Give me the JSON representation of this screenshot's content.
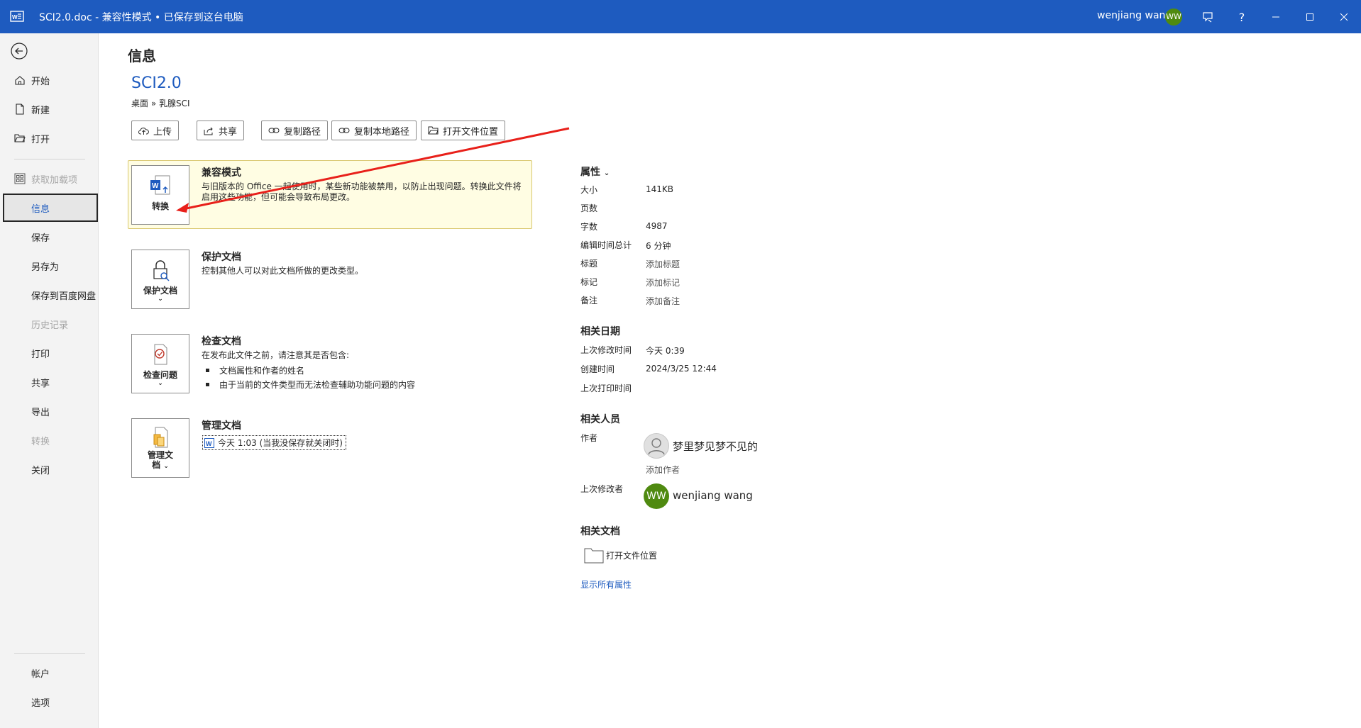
{
  "titlebar": {
    "doc_title": "SCI2.0.doc  -  兼容性模式 • 已保存到这台电脑",
    "user_name": "wenjiang wang",
    "user_initials": "WW"
  },
  "nav": {
    "items": [
      {
        "label": "开始",
        "icon": "home-icon"
      },
      {
        "label": "新建",
        "icon": "new-document-icon"
      },
      {
        "label": "打开",
        "icon": "open-folder-icon"
      },
      {
        "label": "获取加载项",
        "icon": "addins-icon",
        "disabled": true
      },
      {
        "label": "信息",
        "selected": true
      },
      {
        "label": "保存"
      },
      {
        "label": "另存为"
      },
      {
        "label": "保存到百度网盘"
      },
      {
        "label": "历史记录",
        "disabled": true
      },
      {
        "label": "打印"
      },
      {
        "label": "共享"
      },
      {
        "label": "导出"
      },
      {
        "label": "转换",
        "disabled": true
      },
      {
        "label": "关闭"
      }
    ],
    "bottom": [
      {
        "label": "帐户"
      },
      {
        "label": "选项"
      }
    ]
  },
  "main": {
    "page_title": "信息",
    "doc_name": "SCI2.0",
    "breadcrumb": "桌面 » 乳腺SCI",
    "actions": [
      "上传",
      "共享",
      "复制路径",
      "复制本地路径",
      "打开文件位置"
    ],
    "compat": {
      "button_label": "转换",
      "title": "兼容模式",
      "desc": "与旧版本的 Office 一起使用时，某些新功能被禁用，以防止出现问题。转换此文件将启用这些功能，但可能会导致布局更改。"
    },
    "protect": {
      "button_label": "保护文档",
      "title": "保护文档",
      "desc": "控制其他人可以对此文档所做的更改类型。"
    },
    "inspect": {
      "button_label": "检查问题",
      "title": "检查文档",
      "desc": "在发布此文件之前，请注意其是否包含:",
      "bullets": [
        "文档属性和作者的姓名",
        "由于当前的文件类型而无法检查辅助功能问题的内容"
      ]
    },
    "manage": {
      "button_label_1": "管理文",
      "button_label_2": "档",
      "title": "管理文档",
      "version": "今天 1:03 (当我没保存就关闭时)"
    }
  },
  "properties": {
    "heading": "属性",
    "rows": [
      {
        "label": "大小",
        "value": "141KB"
      },
      {
        "label": "页数",
        "value": ""
      },
      {
        "label": "字数",
        "value": "4987"
      },
      {
        "label": "编辑时间总计",
        "value": "6 分钟"
      },
      {
        "label": "标题",
        "value": "添加标题"
      },
      {
        "label": "标记",
        "value": "添加标记"
      },
      {
        "label": "备注",
        "value": "添加备注"
      }
    ],
    "dates_heading": "相关日期",
    "dates": [
      {
        "label": "上次修改时间",
        "value": "今天 0:39"
      },
      {
        "label": "创建时间",
        "value": "2024/3/25 12:44"
      },
      {
        "label": "上次打印时间",
        "value": ""
      }
    ],
    "people_heading": "相关人员",
    "author_label": "作者",
    "author_name": "梦里梦见梦不见的",
    "add_author": "添加作者",
    "last_modified_by_label": "上次修改者",
    "last_modified_by": "wenjiang wang",
    "last_modified_initials": "WW",
    "docs_heading": "相关文档",
    "open_location": "打开文件位置",
    "show_all": "显示所有属性"
  },
  "colors": {
    "titlebar": "#1e5bbf",
    "accent": "#1e5bbf",
    "annotation_arrow": "#e8201a"
  }
}
